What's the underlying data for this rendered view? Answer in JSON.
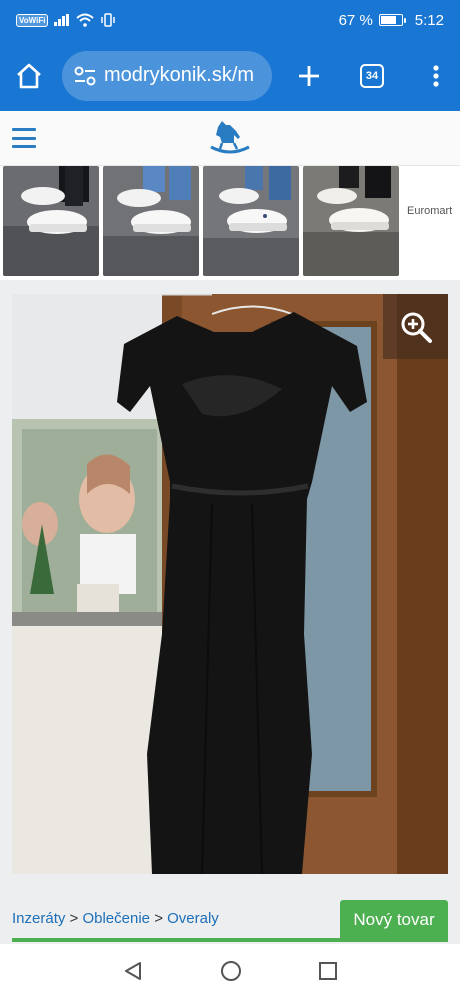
{
  "status_bar": {
    "network_badge": "VoWiFi",
    "battery_percent": "67 %",
    "battery_level": 0.67,
    "time": "5:12"
  },
  "browser": {
    "url": "modrykonik.sk/m",
    "tab_count": "34"
  },
  "ad": {
    "advertiser": "Euromart",
    "thumbnails": [
      "white-sneakers-1",
      "white-sneakers-2",
      "white-sneakers-3",
      "white-sneakers-4"
    ]
  },
  "listing": {
    "image_subject": "black-jumpsuit-on-hanger"
  },
  "breadcrumb": {
    "items": [
      "Inzeráty",
      "Oblečenie",
      "Overaly"
    ],
    "separator": ">"
  },
  "badge": {
    "label": "Nový tovar"
  },
  "colors": {
    "browser_blue": "#1976d2",
    "link_blue": "#1e6fb8",
    "badge_green": "#4caf50"
  },
  "icons": [
    "home-icon",
    "site-settings-icon",
    "new-tab-icon",
    "tabs-icon",
    "menu-dots-icon",
    "hamburger-icon",
    "rocking-horse-logo",
    "zoom-in-icon",
    "back-icon",
    "home-nav-icon",
    "recents-icon"
  ]
}
